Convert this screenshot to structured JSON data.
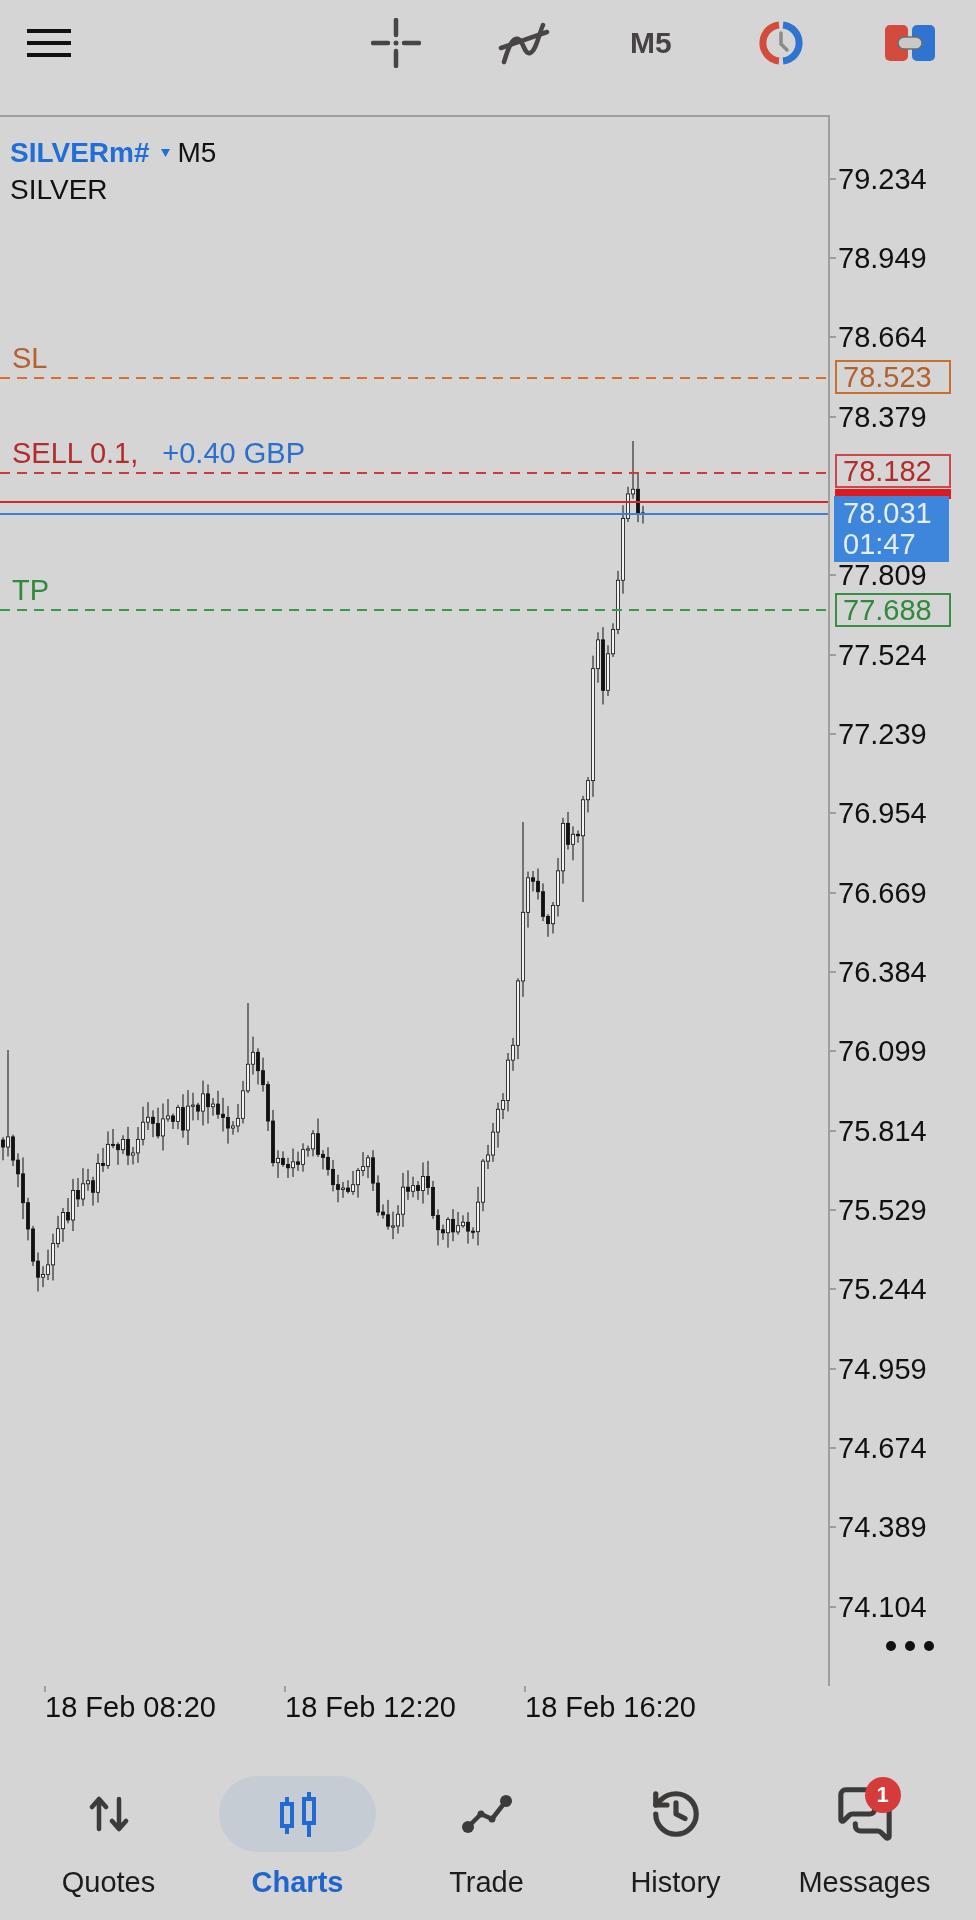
{
  "top_bar": {
    "timeframe": "M5"
  },
  "chart": {
    "symbol": "SILVERm#",
    "timeframe": "M5",
    "description": "SILVER",
    "levels": [
      {
        "kind": "stop_loss",
        "label": "SL",
        "price": "78.523"
      },
      {
        "kind": "order",
        "label": "SELL 0.1,",
        "profit": "+0.40 GBP",
        "price": "78.182"
      },
      {
        "kind": "take_profit",
        "label": "TP",
        "price": "77.688"
      }
    ],
    "bid": {
      "price": "78.031",
      "countdown": "01:47"
    },
    "price_axis": [
      "79.234",
      "78.949",
      "78.664",
      "78.379",
      "77.809",
      "77.524",
      "77.239",
      "76.954",
      "76.669",
      "76.384",
      "76.099",
      "75.814",
      "75.529",
      "75.244",
      "74.959",
      "74.674",
      "74.389",
      "74.104"
    ],
    "time_axis": [
      "18 Feb 08:20",
      "18 Feb 12:20",
      "18 Feb 16:20"
    ]
  },
  "bottom_nav": [
    {
      "label": "Quotes",
      "selected": false
    },
    {
      "label": "Charts",
      "selected": true
    },
    {
      "label": "Trade",
      "selected": false
    },
    {
      "label": "History",
      "selected": false
    },
    {
      "label": "Messages",
      "selected": false,
      "badge": "1"
    }
  ]
}
